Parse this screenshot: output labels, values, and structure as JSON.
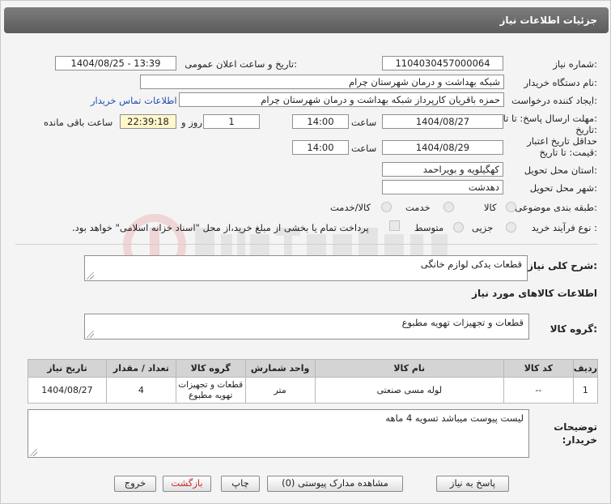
{
  "header": {
    "title": "جزئیات اطلاعات نیاز"
  },
  "form": {
    "need_number_label": "شماره نیاز:",
    "need_number": "1104030457000064",
    "announce_label": "تاریخ و ساعت اعلان عمومی:",
    "announce_value": "1404/08/25 - 13:39",
    "buyer_org_label": "نام دستگاه خریدار:",
    "buyer_org": "شبکه بهداشت و درمان شهرستان چرام",
    "requester_label": "ایجاد کننده درخواست:",
    "requester": "حمزه باقریان کارپرداز شبکه بهداشت و درمان شهرستان چرام",
    "contact_link": "اطلاعات تماس خریدار",
    "reply_deadline_label": "مهلت ارسال پاسخ: تا تاریخ:",
    "reply_date": "1404/08/27",
    "time_label": "ساعت",
    "reply_time": "14:00",
    "days_value": "1",
    "days_label": "روز و",
    "remaining_time": "22:39:18",
    "remaining_label": "ساعت باقی مانده",
    "validity_label": "حداقل تاریخ اعتبار قیمت: تا تاریخ:",
    "validity_date": "1404/08/29",
    "validity_time": "14:00",
    "province_label": "استان محل تحویل:",
    "province": "کهگیلویه و بویراحمد",
    "city_label": "شهر محل تحویل:",
    "city": "دهدشت",
    "category_label": "طبقه بندی موضوعی:",
    "category_options": [
      "کالا",
      "خدمت",
      "کالا/خدمت"
    ],
    "process_label": "نوع فرآیند خرید :",
    "process_options": [
      "جزیی",
      "متوسط"
    ],
    "payment_note": "پرداخت تمام یا بخشی از مبلغ خرید،از محل \"اسناد خزانه اسلامی\" خواهد بود."
  },
  "description": {
    "label": "شرح کلی نیاز:",
    "value": "قطعات یدکی لوازم خانگی"
  },
  "goods": {
    "section_title": "اطلاعات کالاهای مورد نیاز",
    "group_label": "گروه کالا:",
    "group_value": "قطعات و تجهیزات تهویه مطبوع",
    "columns": [
      "ردیف",
      "کد کالا",
      "نام کالا",
      "واحد شمارش",
      "گروه کالا",
      "تعداد / مقدار",
      "تاریخ نیاز"
    ],
    "rows": [
      {
        "row": "1",
        "code": "--",
        "name": "لوله مسی صنعتی",
        "unit": "متر",
        "group": "قطعات و تجهیزات تهویه مطبوع",
        "qty": "4",
        "date": "1404/08/27"
      }
    ]
  },
  "buyer_notes": {
    "label": "توضیحات خریدار:",
    "value": "لیست پیوست میباشد تسویه 4 ماهه"
  },
  "buttons": {
    "reply": "پاسخ به نیاز",
    "attachments": "مشاهده مدارک پیوستی (0)",
    "print": "چاپ",
    "back": "بازگشت",
    "exit": "خروج"
  },
  "colors": {
    "title_bar": "#6b6b6b",
    "link": "#1e4fb5",
    "remaining_bg": "#fff8cc",
    "danger_text": "#c62828"
  }
}
